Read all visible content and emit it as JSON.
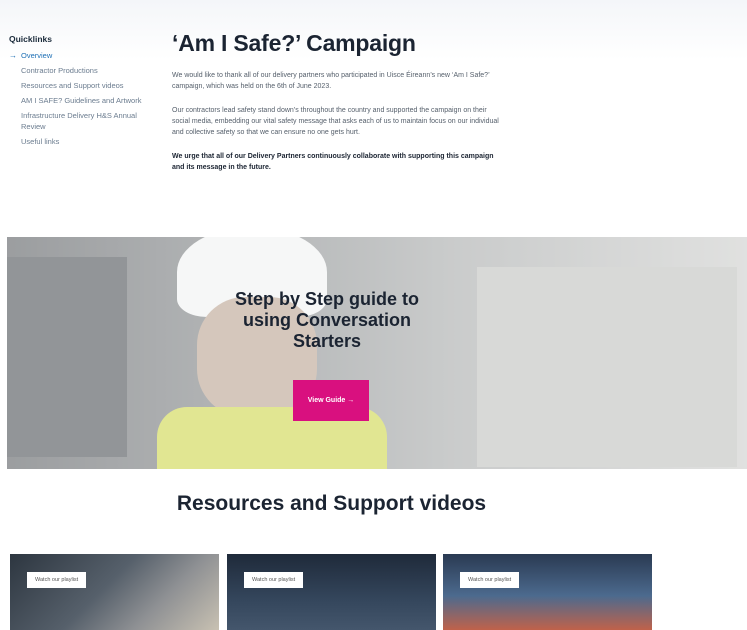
{
  "quicklinks": {
    "title": "Quicklinks",
    "items": [
      {
        "label": "Overview"
      },
      {
        "label": "Contractor Productions"
      },
      {
        "label": "Resources and Support videos"
      },
      {
        "label": "AM I SAFE? Guidelines and Artwork"
      },
      {
        "label": "Infrastructure Delivery H&S Annual Review"
      },
      {
        "label": "Useful links"
      }
    ],
    "arrow_icon": "arrow-right-icon"
  },
  "main": {
    "title": "‘Am I Safe?’ Campaign",
    "paragraphs": [
      "We would like to thank all of our delivery partners who participated in Uisce Éireann’s new ‘Am I Safe?’ campaign, which was held on the 6th of June 2023.",
      "Our contractors lead safety stand down’s throughout the country and supported the campaign on their social media, embedding our vital safety message that asks each of us to maintain focus on our individual and collective safety so that we can ensure no one gets hurt."
    ],
    "bold_paragraph": "We urge that all of our Delivery Partners continuously collaborate with supporting this campaign and its message in the future."
  },
  "banner": {
    "heading": "Step by Step guide to using Conversation Starters",
    "button_label": "View Guide →",
    "button_color": "#d9107f"
  },
  "resources": {
    "title": "Resources and Support videos",
    "cards": [
      {
        "label": "Watch our playlist"
      },
      {
        "label": "Watch our playlist"
      },
      {
        "label": "Watch our playlist"
      }
    ]
  },
  "colors": {
    "accent": "#1d6fb5",
    "heading": "#1b2432",
    "cta": "#d9107f"
  }
}
